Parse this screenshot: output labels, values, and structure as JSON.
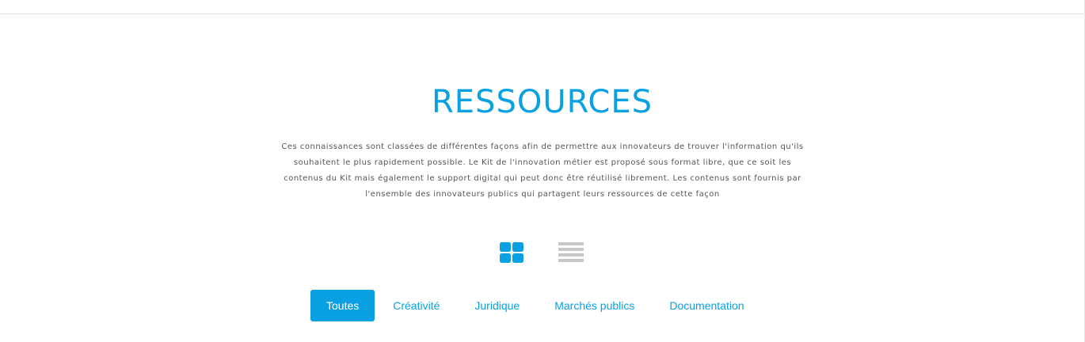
{
  "section": {
    "title": "RESSOURCES",
    "intro": "Ces connaissances sont classées de différentes façons afin de permettre aux innovateurs de trouver l'information qu'ils souhaitent le plus rapidement possible. Le Kit de l'innovation métier est proposé sous format libre, que ce soit les contenus du Kit mais également le support digital qui peut donc être réutilisé librement. Les contenus sont fournis par l'ensemble des innovateurs publics qui partagent leurs ressources de cette façon"
  },
  "view_toggle": {
    "options": [
      {
        "icon": "grid-view-icon",
        "active": true
      },
      {
        "icon": "list-view-icon",
        "active": false
      }
    ]
  },
  "filters": {
    "items": [
      {
        "label": "Toutes",
        "active": true
      },
      {
        "label": "Créativité",
        "active": false
      },
      {
        "label": "Juridique",
        "active": false
      },
      {
        "label": "Marchés publics",
        "active": false
      },
      {
        "label": "Documentation",
        "active": false
      }
    ]
  },
  "colors": {
    "accent": "#0aa1e2",
    "text": "#555555",
    "inactive_icon": "#c8c8c8"
  }
}
